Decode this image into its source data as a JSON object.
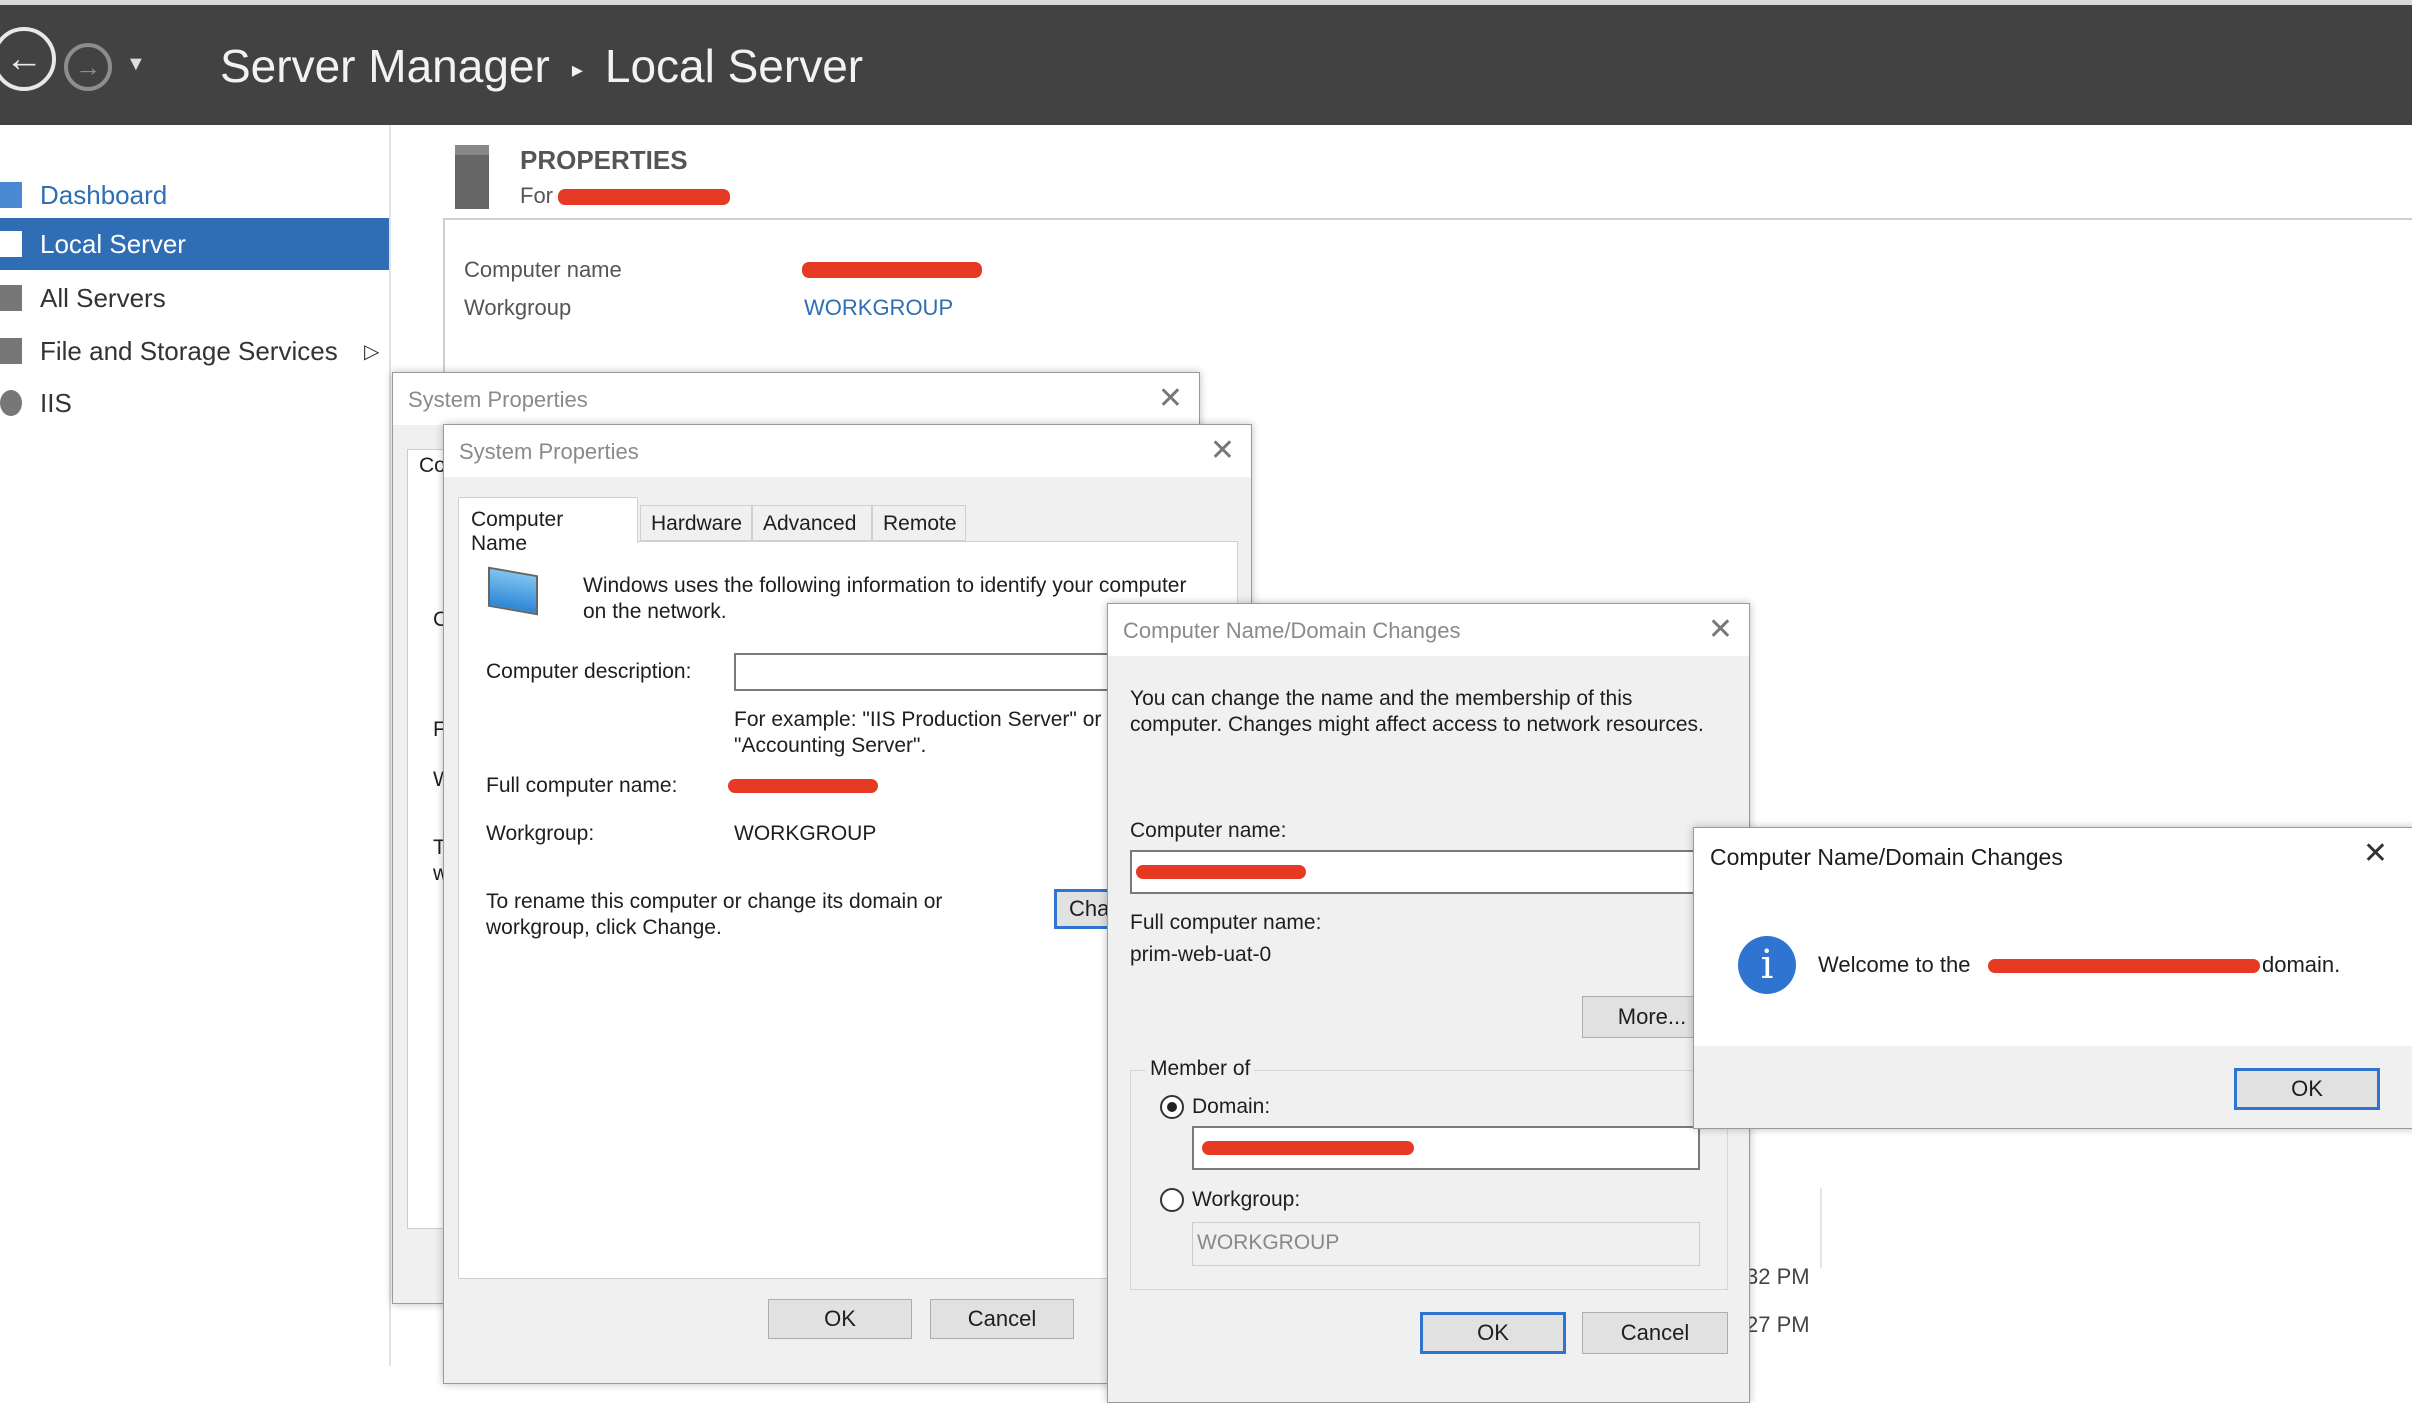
{
  "header": {
    "app": "Server Manager",
    "page": "Local Server"
  },
  "sidebar": {
    "items": [
      {
        "label": "Dashboard",
        "icon": "dashboard-icon"
      },
      {
        "label": "Local Server",
        "icon": "server-icon",
        "active": true
      },
      {
        "label": "All Servers",
        "icon": "servers-icon"
      },
      {
        "label": "File and Storage Services",
        "icon": "storage-icon"
      },
      {
        "label": "IIS",
        "icon": "iis-icon"
      }
    ]
  },
  "properties": {
    "title": "PROPERTIES",
    "for_prefix": "For",
    "rows": [
      {
        "label": "Computer name"
      },
      {
        "label": "Workgroup",
        "value": "WORKGROUP"
      }
    ]
  },
  "sys_back": {
    "title": "System Properties",
    "partial": [
      "Co",
      "C",
      "F",
      "W",
      "T",
      "w"
    ]
  },
  "sys": {
    "title": "System Properties",
    "tabs": [
      "Computer Name",
      "Hardware",
      "Advanced",
      "Remote"
    ],
    "intro": "Windows uses the following information to identify your computer",
    "intro2": "on the network.",
    "desc_label": "Computer description:",
    "desc_value": "",
    "example1": "For example: \"IIS Production Server\" or",
    "example2": "\"Accounting Server\".",
    "full_label": "Full computer name:",
    "wg_label": "Workgroup:",
    "wg_value": "WORKGROUP",
    "rename1": "To rename this computer or change its domain or",
    "rename2": "workgroup, click Change.",
    "change": "Cha",
    "ok": "OK",
    "cancel": "Cancel"
  },
  "cnd": {
    "title": "Computer Name/Domain Changes",
    "intro1": "You can change the name and the membership of this",
    "intro2": "computer. Changes might affect access to network resources.",
    "name_label": "Computer name:",
    "full_label": "Full computer name:",
    "full_value": "prim-web-uat-0",
    "more": "More...",
    "member_of": "Member of",
    "domain_label": "Domain:",
    "domain_selected": true,
    "workgroup_label": "Workgroup:",
    "workgroup_value": "WORKGROUP",
    "ok": "OK",
    "cancel": "Cancel"
  },
  "msg": {
    "title": "Computer Name/Domain Changes",
    "prefix": "Welcome to the",
    "suffix": "domain.",
    "ok": "OK",
    "icon": "info-icon"
  },
  "background": {
    "times": [
      "32 PM",
      "27 PM"
    ]
  }
}
